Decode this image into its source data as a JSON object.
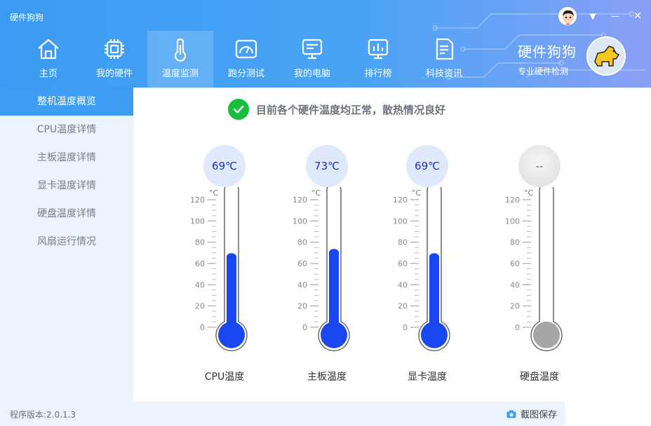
{
  "window": {
    "title": "硬件狗狗",
    "controls": {
      "menu": "▼",
      "minimize": "—",
      "close": "✕"
    }
  },
  "nav": {
    "items": [
      {
        "label": "主页",
        "icon": "home-icon"
      },
      {
        "label": "我的硬件",
        "icon": "chip-icon"
      },
      {
        "label": "温度监测",
        "icon": "thermometer-icon"
      },
      {
        "label": "跑分测试",
        "icon": "speedometer-icon"
      },
      {
        "label": "我的电脑",
        "icon": "monitor-icon"
      },
      {
        "label": "排行榜",
        "icon": "ranking-icon"
      },
      {
        "label": "科技资讯",
        "icon": "news-icon"
      }
    ],
    "active_index": 2
  },
  "brand": {
    "name": "硬件狗狗",
    "subtitle": "专业硬件检测"
  },
  "sidebar": {
    "items": [
      {
        "label": "整机温度概览"
      },
      {
        "label": "CPU温度详情"
      },
      {
        "label": "主板温度详情"
      },
      {
        "label": "显卡温度详情"
      },
      {
        "label": "硬盘温度详情"
      },
      {
        "label": "风扇运行情况"
      }
    ],
    "active_index": 0
  },
  "status": {
    "text": "目前各个硬件温度均正常，散热情况良好"
  },
  "gauges": {
    "unit": "°C",
    "ticks": [
      "120",
      "100",
      "80",
      "60",
      "40",
      "20",
      "0"
    ],
    "items": [
      {
        "reading": "69℃",
        "label": "CPU温度",
        "value": 69,
        "fill_color": "#1a47f2"
      },
      {
        "reading": "73℃",
        "label": "主板温度",
        "value": 73,
        "fill_color": "#1a47f2"
      },
      {
        "reading": "69℃",
        "label": "显卡温度",
        "value": 69,
        "fill_color": "#1a47f2"
      },
      {
        "reading": "--",
        "label": "硬盘温度",
        "value": 0,
        "fill_color": "#a6a6a6"
      }
    ]
  },
  "footer": {
    "version": "程序版本:2.0.1.3",
    "save_label": "截图保存"
  },
  "colors": {
    "header_start": "#3b9bf2",
    "accent": "#3d9df3",
    "ok_green": "#17bf3c",
    "mercury_blue": "#1a47f2"
  }
}
